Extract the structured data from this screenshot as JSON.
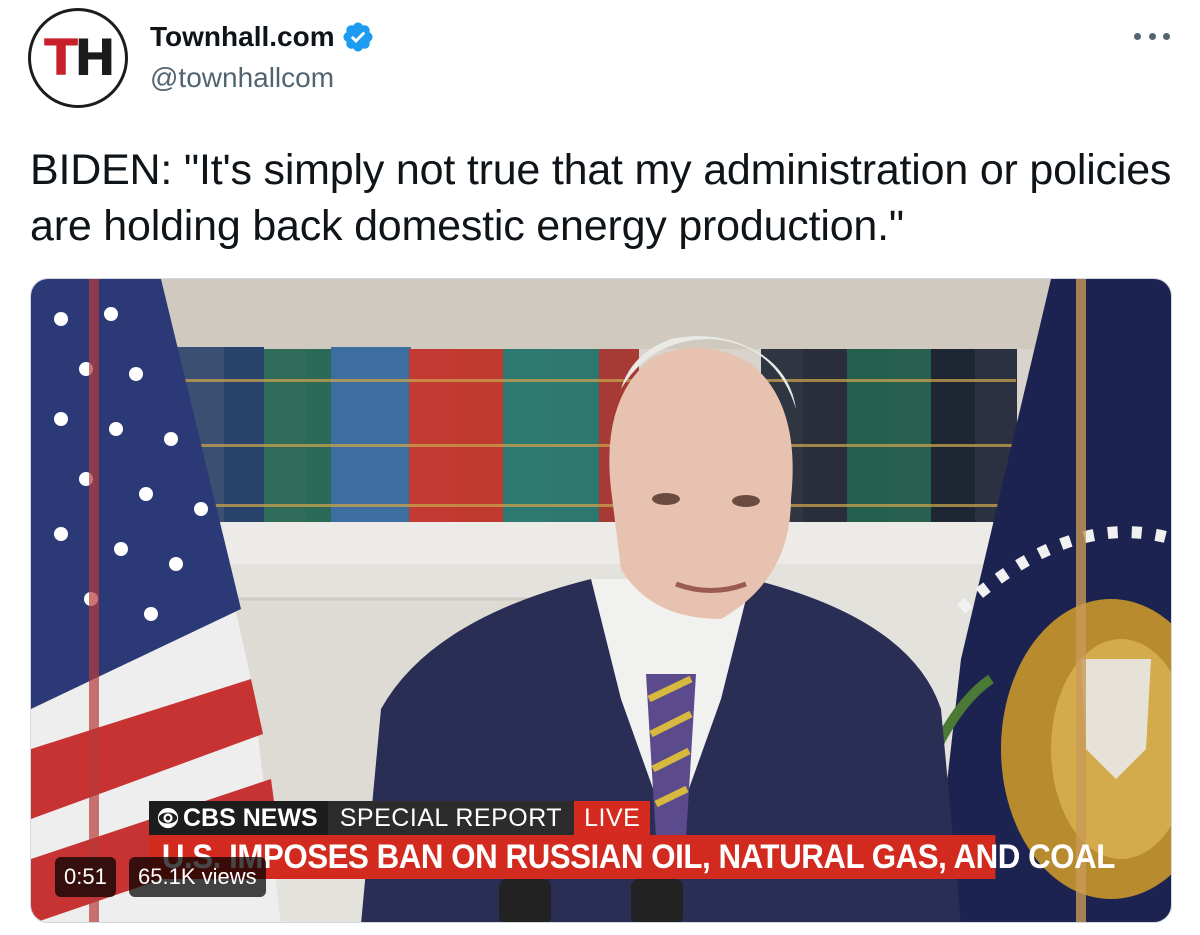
{
  "author": {
    "avatar_text_t": "T",
    "avatar_text_h": "H",
    "display_name": "Townhall.com",
    "handle": "@townhallcom",
    "verified": true
  },
  "tweet": {
    "text": "BIDEN: \"It's simply not true that my administration or policies are holding back domestic energy production.\""
  },
  "video": {
    "duration": "0:51",
    "views": "65.1K views",
    "overlay": {
      "network": "CBS NEWS",
      "segment": "SPECIAL REPORT",
      "live": "LIVE",
      "ticker": "U.S. IMPOSES BAN ON RUSSIAN OIL, NATURAL GAS, AND COAL"
    }
  },
  "icons": {
    "verified": "verified-badge-icon",
    "more": "more-options-icon"
  },
  "colors": {
    "verified_blue": "#1d9bf0",
    "cbs_red": "#d32a1f",
    "avatar_red": "#c8202b"
  }
}
